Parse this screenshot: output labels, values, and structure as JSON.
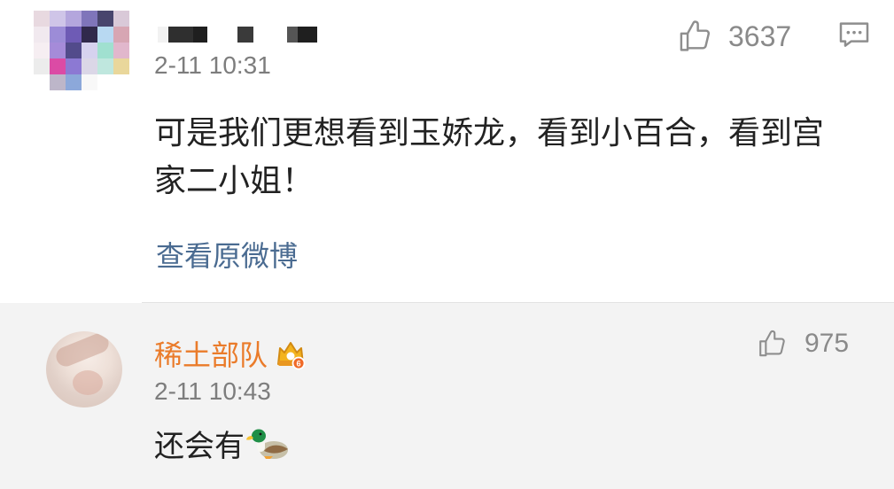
{
  "comments": [
    {
      "timestamp": "2-11 10:31",
      "like_count": "3637",
      "text": "可是我们更想看到玉娇龙，看到小百合，看到宫家二小姐！",
      "view_original_label": "查看原微博",
      "icons": {
        "avatar": "pixelated-avatar",
        "username": "pixelated-username",
        "like": "thumbs-up-icon",
        "reply": "comment-icon"
      }
    },
    {
      "username": "稀土部队",
      "timestamp": "2-11 10:43",
      "like_count": "975",
      "text": "还会有",
      "icons": {
        "avatar": "photo-avatar",
        "badge": "vip-crown-badge-icon",
        "like": "thumbs-up-icon",
        "emoji": "duck-emoji"
      }
    }
  ],
  "colors": {
    "username_orange": "#ea7b2a",
    "link_blue": "#4a6b91",
    "muted_gray": "#8a8a8a",
    "body_text": "#222222",
    "reply_background": "#f3f3f3"
  }
}
